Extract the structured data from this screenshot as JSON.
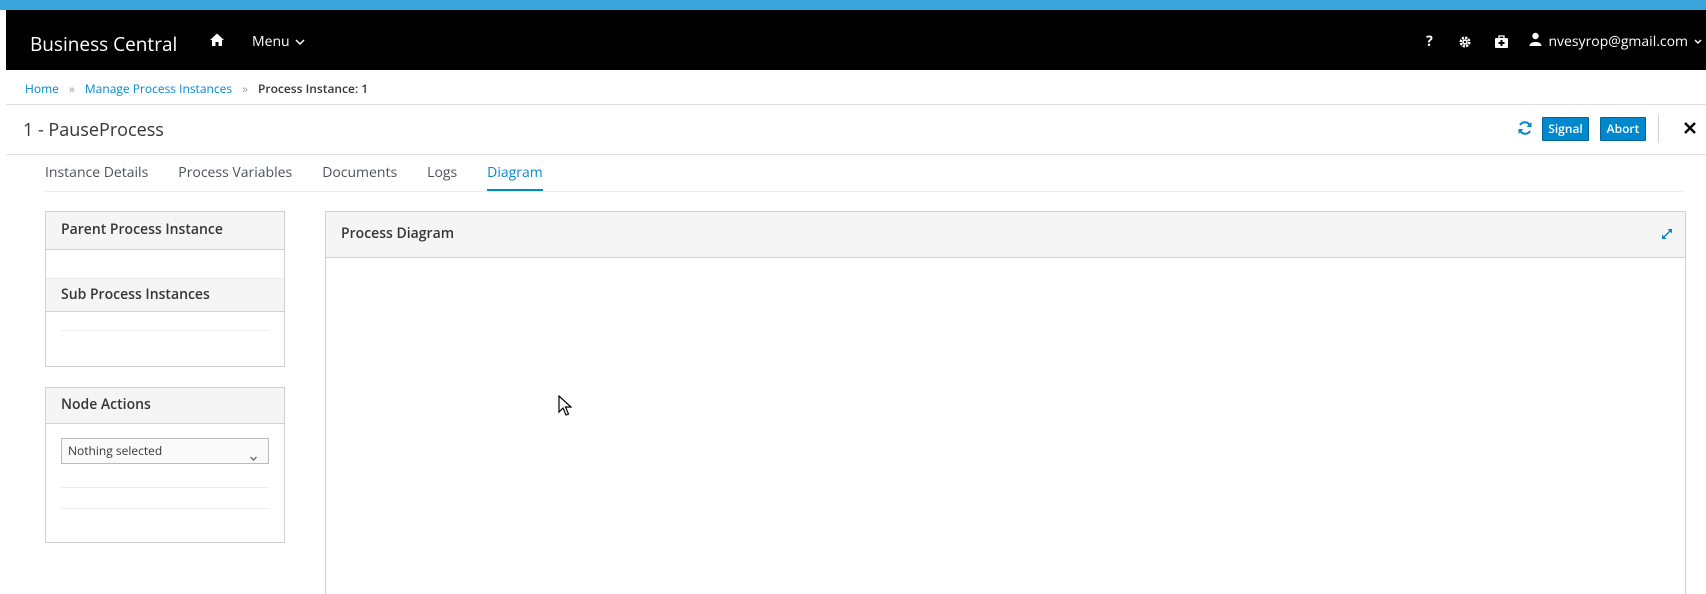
{
  "colors": {
    "accent": "#0088ce",
    "topbar_accent": "#39a5dc",
    "navbar": "#000000"
  },
  "navbar": {
    "brand": "Business Central",
    "home_icon": "home-icon",
    "menu_label": "Menu",
    "right_icons": [
      "help-icon",
      "gear-icon",
      "medkit-icon"
    ],
    "user": "nvesyrop@gmail.com"
  },
  "breadcrumb": {
    "items": [
      "Home",
      "Manage Process Instances"
    ],
    "current": "Process Instance: 1",
    "separator": "»"
  },
  "header": {
    "title": "1 - PauseProcess",
    "signal_label": "Signal",
    "abort_label": "Abort"
  },
  "tabs": [
    {
      "label": "Instance Details",
      "active": false
    },
    {
      "label": "Process Variables",
      "active": false
    },
    {
      "label": "Documents",
      "active": false
    },
    {
      "label": "Logs",
      "active": false
    },
    {
      "label": "Diagram",
      "active": true
    }
  ],
  "panels": {
    "parent_title": "Parent Process Instance",
    "sub_title": "Sub Process Instances",
    "node_actions_title": "Node Actions",
    "node_select_value": "Nothing selected",
    "diagram_title": "Process Diagram"
  }
}
